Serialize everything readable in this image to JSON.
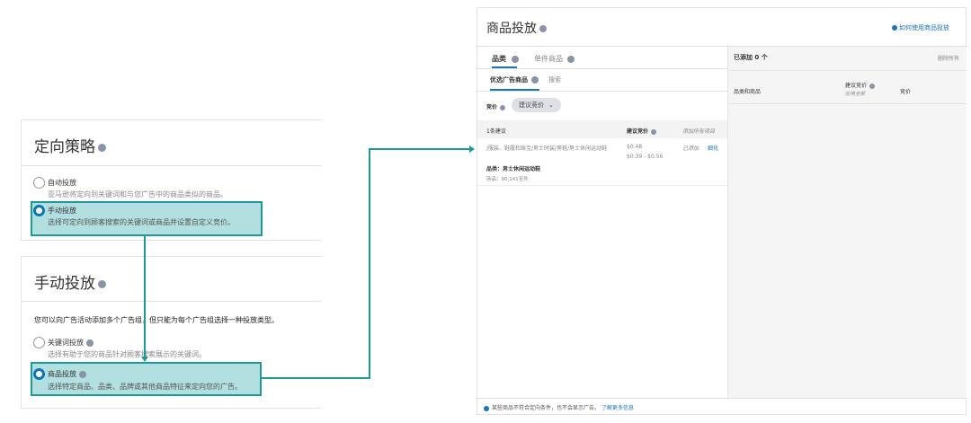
{
  "targeting_strategy": {
    "title": "定向策略",
    "options": [
      {
        "label": "自动投放",
        "desc": "亚马逊将定向到关键词和与您广告中的商品类似的商品。",
        "selected": false
      },
      {
        "label": "手动投放",
        "desc": "选择可定向到顾客搜索的关键词或商品并设置自定义竞价。",
        "selected": true
      }
    ]
  },
  "manual_targeting": {
    "title": "手动投放",
    "intro": "您可以向广告活动添加多个广告组，但只能为每个广告组选择一种投放类型。",
    "options": [
      {
        "label": "关键词投放",
        "desc": "选择有助于您的商品针对顾客搜索展示的关键词。",
        "selected": false
      },
      {
        "label": "商品投放",
        "desc": "选择特定商品、品类、品牌或其他商品特征来定向您的广告。",
        "selected": true
      }
    ]
  },
  "product_targeting": {
    "title": "商品投放",
    "help_link": "如何使用商品投放",
    "tabs": [
      "品类",
      "单件商品"
    ],
    "subtabs": [
      "优选广告商品",
      "搜索"
    ],
    "bid_label": "竞价",
    "bid_select": "建议竞价",
    "table": {
      "count_label": "1条建议",
      "col_bid": "建议竞价",
      "add_all": "添加所有项目",
      "rows": [
        {
          "path": "/服装、鞋履和珠宝/男士时装/男鞋/男士休闲运动鞋",
          "category": "品类：男士休闲运动鞋",
          "products": "商品：90,141至件",
          "bid": "$0.48",
          "range": "$0.39 - $0.56",
          "status": "已添加",
          "action": "细化"
        }
      ]
    },
    "footer_note": "某些商品不符合定向条件，也不会显示广告。",
    "footer_link": "了解更多信息",
    "added": {
      "title": "已添加 0 个",
      "remove_all": "删除所有",
      "col_item": "品类和商品",
      "col_suggested": "建议竞价",
      "apply_all": "应用全部",
      "col_bid": "竞价"
    }
  },
  "colors": {
    "accent": "#1e9a96",
    "highlight": "#b2dfe0",
    "link": "#1a75b8"
  }
}
